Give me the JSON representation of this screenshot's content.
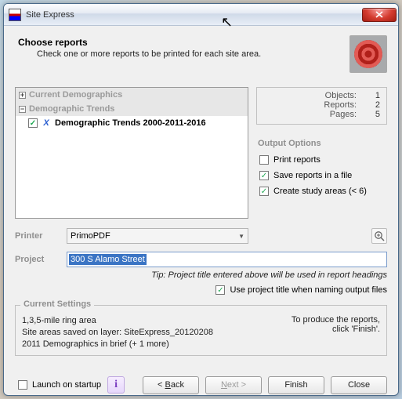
{
  "window": {
    "title": "Site Express"
  },
  "header": {
    "title": "Choose reports",
    "subtitle": "Check one or more reports to be printed for each site area."
  },
  "tree": {
    "group1": "Current Demographics",
    "group2": "Demographic Trends",
    "item1": {
      "label": "Demographic Trends 2000-2011-2016",
      "checked": true
    }
  },
  "stats": {
    "objects_lbl": "Objects:",
    "objects_val": "1",
    "reports_lbl": "Reports:",
    "reports_val": "2",
    "pages_lbl": "Pages:",
    "pages_val": "5"
  },
  "output": {
    "title": "Output Options",
    "print": {
      "label": "Print reports",
      "checked": false
    },
    "save": {
      "label": "Save reports in a file",
      "checked": true
    },
    "study": {
      "label": "Create study areas (< 6)",
      "checked": true
    }
  },
  "printer": {
    "label": "Printer",
    "value": "PrimoPDF"
  },
  "project": {
    "label": "Project",
    "value": "300 S Alamo Street",
    "tip": "Tip: Project title entered above will be used in report headings",
    "use_title": {
      "label": "Use project title when naming output files",
      "checked": true
    }
  },
  "current": {
    "legend": "Current Settings",
    "line1": "1,3,5-mile ring area",
    "line2": "Site areas saved on layer: SiteExpress_20120208",
    "line3": "2011 Demographics in brief (+ 1 more)",
    "hint1": "To produce the reports,",
    "hint2": "click 'Finish'."
  },
  "footer": {
    "launch": {
      "label": "Launch on startup",
      "checked": false
    },
    "back": "< Back",
    "next": "Next >",
    "finish": "Finish",
    "close": "Close"
  }
}
